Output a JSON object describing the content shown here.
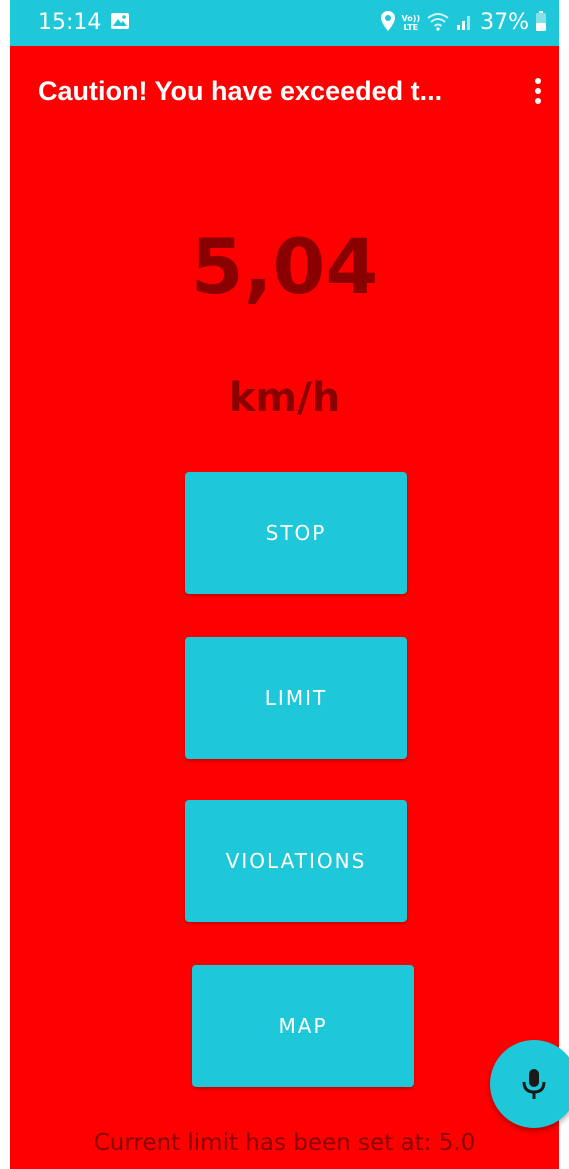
{
  "status_bar": {
    "time": "15:14",
    "lte_top": "Vo))",
    "lte_bottom": "LTE",
    "battery_percent": "37%"
  },
  "app_bar": {
    "title": "Caution! You have exceeded t...",
    "menu_icon": "more-vert-icon"
  },
  "speed": {
    "value": "5,04",
    "unit": "km/h"
  },
  "buttons": {
    "stop": "STOP",
    "limit": "LIMIT",
    "violations": "VIOLATIONS",
    "map": "MAP"
  },
  "fab": {
    "icon": "microphone-icon"
  },
  "footer": {
    "limit_text": "Current limit has been set at: 5.0"
  },
  "colors": {
    "alert_background": "#ff0000",
    "accent": "#1ec8d8",
    "speed_text": "#8a0000"
  }
}
